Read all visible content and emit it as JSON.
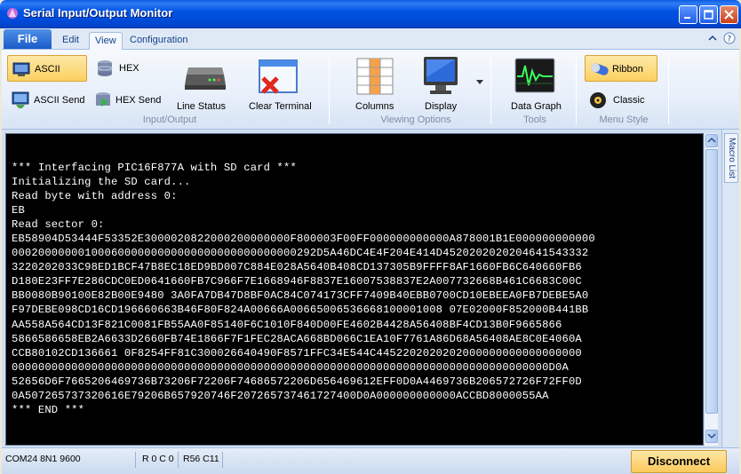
{
  "window": {
    "title": "Serial Input/Output Monitor"
  },
  "tabs": {
    "file": "File",
    "edit": "Edit",
    "view": "View",
    "configuration": "Configuration"
  },
  "ribbon": {
    "input_output": {
      "label": "Input/Output",
      "ascii": "ASCII",
      "hex": "HEX",
      "ascii_send": "ASCII Send",
      "hex_send": "HEX Send",
      "line_status": "Line Status",
      "clear_terminal": "Clear Terminal"
    },
    "viewing_options": {
      "label": "Viewing Options",
      "columns": "Columns",
      "display": "Display"
    },
    "tools": {
      "label": "Tools",
      "data_graph": "Data Graph"
    },
    "menu_style": {
      "label": "Menu Style",
      "ribbon": "Ribbon",
      "classic": "Classic"
    }
  },
  "terminal": {
    "lines": [
      "*** Interfacing PIC16F877A with SD card ***",
      "Initializing the SD card...",
      "Read byte with address 0:",
      "EB",
      "Read sector 0:",
      "EB58904D53444F53352E3000020822000200000000F800003F00FF000000000000A878001B1E000000000000",
      "0002000000010006000000000000000000000000000292D5A46DC4E4F204E414D4520202020204641543332",
      "3220202033C98ED1BCF47B8EC18ED9BD007C884E028A5640B408CD137305B9FFFF8AF1660FB6C640660FB6",
      "D180E23FF7E286CDC0ED0641660FB7C966F7E1668946F8837E16007538837E2A007732668B461C6683C00C",
      "BB0080B90100E82B00E9480 3A0FA7DB47D8BF0AC84C074173CFF7409B40EBB0700CD10EBEEA0FB7DEBE5A0",
      "F97DEBE098CD16CD196660663B46F80F824A00666A00665006536668100001008 07E02000F852000B441BB",
      "AA558A564CD13F821C0081FB55AA0F85140F6C1010F840D00FE4602B4428A56408BF4CD13B0F9665866",
      "5866586658EB2A6633D2660FB74E1866F7F1FEC28ACA668BD066C1EA10F7761A86D68A56408AE8C0E4060A",
      "CCB80102CD136661 0F8254FF81C300026640490F8571FFC34E544C4452202020202000000000000000000",
      "000000000000000000000000000000000000000000000000000000000000000000000000000000000D0A",
      "52656D6F7665206469736B73206F72206F74686572206D656469612EFF0D0A4469736B206572726F72FF0D",
      "0A507265737320616E79206B657920746F207265737461727400D0A000000000000ACCBD8000055AA",
      "*** END ***"
    ]
  },
  "status": {
    "port": "COM24 8N1 9600",
    "rc": "R 0 C 0",
    "rc2": "R56 C11",
    "disconnect": "Disconnect"
  },
  "side_panel": {
    "macro_list": "Macro List"
  }
}
